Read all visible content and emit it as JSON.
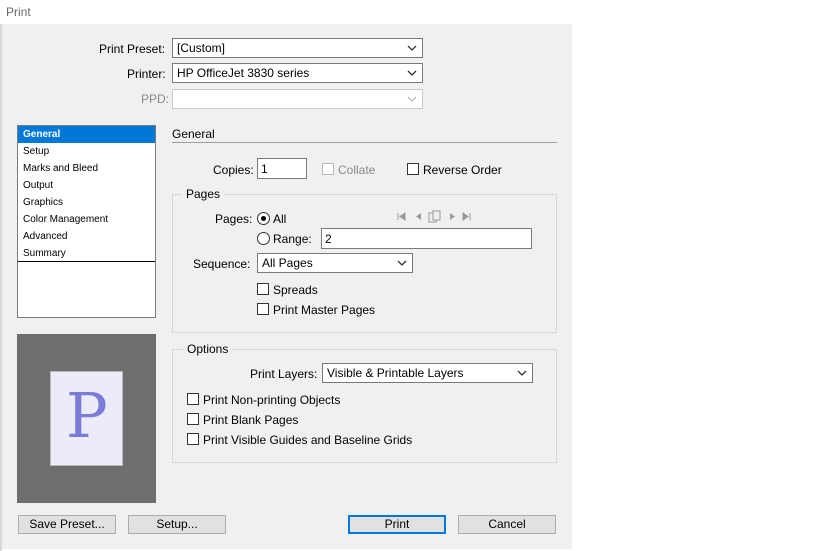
{
  "window": {
    "title": "Print"
  },
  "top": {
    "print_preset_label": "Print Preset:",
    "print_preset_value": "[Custom]",
    "printer_label": "Printer:",
    "printer_value": "HP OfficeJet 3830 series",
    "ppd_label": "PPD:",
    "ppd_value": ""
  },
  "sidebar": {
    "items": [
      {
        "label": "General"
      },
      {
        "label": "Setup"
      },
      {
        "label": "Marks and Bleed"
      },
      {
        "label": "Output"
      },
      {
        "label": "Graphics"
      },
      {
        "label": "Color Management"
      },
      {
        "label": "Advanced"
      },
      {
        "label": "Summary"
      }
    ],
    "selected": "General"
  },
  "preview": {
    "letter": "P"
  },
  "general": {
    "title": "General",
    "copies_label": "Copies:",
    "copies_value": "1",
    "collate_label": "Collate",
    "reverse_order_label": "Reverse Order"
  },
  "pages": {
    "title": "Pages",
    "pages_label": "Pages:",
    "all_label": "All",
    "range_label": "Range:",
    "range_value": "2",
    "sequence_label": "Sequence:",
    "sequence_value": "All Pages",
    "spreads_label": "Spreads",
    "print_master_pages_label": "Print Master Pages"
  },
  "options": {
    "title": "Options",
    "print_layers_label": "Print Layers:",
    "print_layers_value": "Visible & Printable Layers",
    "non_printing_label": "Print Non-printing Objects",
    "blank_pages_label": "Print Blank Pages",
    "guides_label": "Print Visible Guides and Baseline Grids"
  },
  "buttons": {
    "save_preset": "Save Preset...",
    "setup": "Setup...",
    "print": "Print",
    "cancel": "Cancel"
  }
}
